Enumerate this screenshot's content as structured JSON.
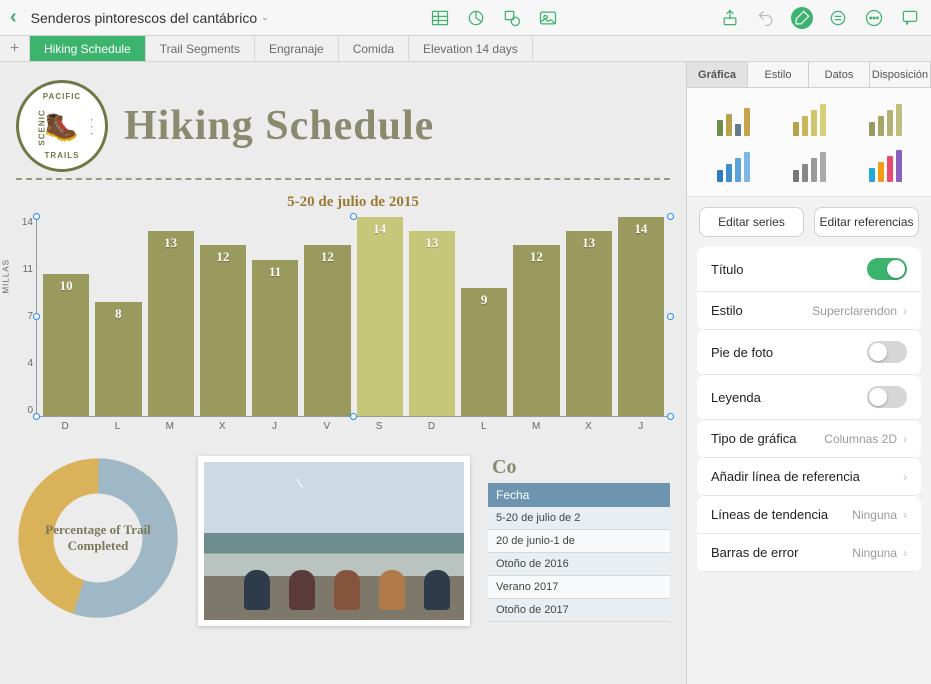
{
  "doc_title": "Senderos pintorescos del cantábrico",
  "toolbar_icons": {
    "table": "table-icon",
    "chart": "piechart-icon",
    "shape": "shape-icon",
    "media": "media-icon",
    "share": "share-icon",
    "undo": "undo-icon",
    "format": "brush-icon",
    "cell": "cell-icon",
    "more": "more-icon",
    "comment": "comment-icon"
  },
  "sheet_tabs": [
    "Hiking Schedule",
    "Trail Segments",
    "Engranaje",
    "Comida",
    "Elevation 14 days"
  ],
  "active_sheet": 0,
  "page": {
    "title": "Hiking Schedule",
    "logo": {
      "top": "PACIFIC",
      "bottom": "TRAILS",
      "left": "SCENIC",
      "right": "· · ·"
    }
  },
  "chart_data": {
    "type": "bar",
    "title": "5-20 de julio de 2015",
    "ylabel": "MILLAS",
    "ylim": [
      0,
      14
    ],
    "yticks": [
      0,
      4,
      7,
      11,
      14
    ],
    "categories": [
      "D",
      "L",
      "M",
      "X",
      "J",
      "V",
      "S",
      "D",
      "L",
      "M",
      "X",
      "J"
    ],
    "values": [
      10,
      8,
      13,
      12,
      11,
      12,
      14,
      13,
      9,
      12,
      13,
      14
    ],
    "alt_index": [
      6,
      7
    ]
  },
  "donut": {
    "caption": "Percentage of Trail Completed",
    "slices": [
      {
        "color": "#9fb8c7",
        "pct": 55
      },
      {
        "color": "#d9b25a",
        "pct": 45
      }
    ]
  },
  "photo": {
    "people_colors": [
      "#2e3b4a",
      "#5a3a3a",
      "#86543c",
      "#b07a4a",
      "#2e3b4a"
    ]
  },
  "table": {
    "title": "Co",
    "header": "Fecha",
    "rows": [
      "5-20 de julio de 2",
      "20 de junio-1 de",
      "Otoño de 2016",
      "Verano 2017",
      "Otoño de 2017"
    ]
  },
  "inspector": {
    "tabs": [
      "Gráfica",
      "Estilo",
      "Datos",
      "Disposición"
    ],
    "active_tab": 0,
    "style_swatches": [
      [
        [
          "#6e8f49",
          16
        ],
        [
          "#b7a24a",
          22
        ],
        [
          "#5f7b8c",
          12
        ],
        [
          "#c7a54a",
          28
        ]
      ],
      [
        [
          "#b7a24a",
          14
        ],
        [
          "#c7b75a",
          20
        ],
        [
          "#d0c56a",
          26
        ],
        [
          "#d8cf7a",
          32
        ]
      ],
      [
        [
          "#9a9a5e",
          14
        ],
        [
          "#a6a668",
          20
        ],
        [
          "#b2b272",
          26
        ],
        [
          "#bebf7c",
          32
        ]
      ],
      [
        [
          "#2f7bbf",
          12
        ],
        [
          "#3f8fcf",
          18
        ],
        [
          "#5aa3db",
          24
        ],
        [
          "#7bb8e6",
          30
        ]
      ],
      [
        [
          "#777",
          12
        ],
        [
          "#888",
          18
        ],
        [
          "#999",
          24
        ],
        [
          "#aaa",
          30
        ]
      ],
      [
        [
          "#1fa8d8",
          14
        ],
        [
          "#f49b1b",
          20
        ],
        [
          "#e94b6e",
          26
        ],
        [
          "#8a5fbf",
          32
        ]
      ]
    ],
    "edit_series": "Editar series",
    "edit_refs": "Editar referencias",
    "rows": {
      "titulo": "Título",
      "estilo": "Estilo",
      "estilo_val": "Superclarendon",
      "pie": "Pie de foto",
      "leyenda": "Leyenda",
      "tipo": "Tipo de gráfica",
      "tipo_val": "Columnas 2D",
      "ref_line": "Añadir línea de referencia",
      "tendencia": "Líneas de tendencia",
      "tendencia_val": "Ninguna",
      "error": "Barras de error",
      "error_val": "Ninguna"
    },
    "toggles": {
      "titulo": true,
      "pie": false,
      "leyenda": false
    }
  }
}
